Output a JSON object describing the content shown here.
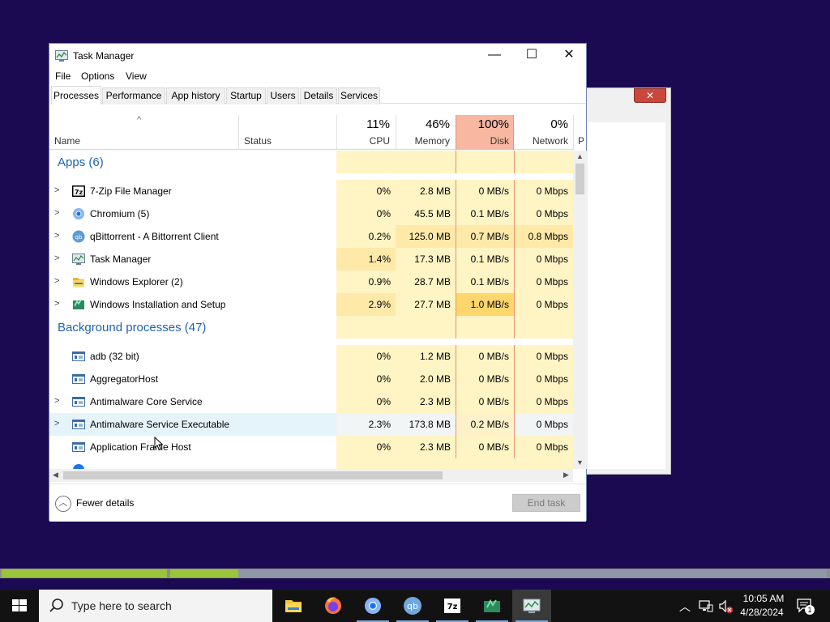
{
  "window": {
    "title": "Task Manager"
  },
  "menu": [
    "File",
    "Options",
    "View"
  ],
  "tabs": [
    "Processes",
    "Performance",
    "App history",
    "Startup",
    "Users",
    "Details",
    "Services"
  ],
  "columns": {
    "name": "Name",
    "status": "Status",
    "cpu": {
      "pct": "11%",
      "label": "CPU"
    },
    "memory": {
      "pct": "46%",
      "label": "Memory"
    },
    "disk": {
      "pct": "100%",
      "label": "Disk"
    },
    "network": {
      "pct": "0%",
      "label": "Network"
    },
    "power": "P"
  },
  "groups": {
    "apps": "Apps (6)",
    "background": "Background processes (47)"
  },
  "apps": [
    {
      "name": "7-Zip File Manager",
      "cpu": "0%",
      "memory": "2.8 MB",
      "disk": "0 MB/s",
      "network": "0 Mbps",
      "icon": "sevenzip-icon"
    },
    {
      "name": "Chromium (5)",
      "cpu": "0%",
      "memory": "45.5 MB",
      "disk": "0.1 MB/s",
      "network": "0 Mbps",
      "icon": "chromium-icon"
    },
    {
      "name": "qBittorrent - A Bittorrent Client",
      "cpu": "0.2%",
      "memory": "125.0 MB",
      "disk": "0.7 MB/s",
      "network": "0.8 Mbps",
      "icon": "qbittorrent-icon"
    },
    {
      "name": "Task Manager",
      "cpu": "1.4%",
      "memory": "17.3 MB",
      "disk": "0.1 MB/s",
      "network": "0 Mbps",
      "icon": "task-manager-icon"
    },
    {
      "name": "Windows Explorer (2)",
      "cpu": "0.9%",
      "memory": "28.7 MB",
      "disk": "0.1 MB/s",
      "network": "0 Mbps",
      "icon": "explorer-icon"
    },
    {
      "name": "Windows Installation and Setup",
      "cpu": "2.9%",
      "memory": "27.7 MB",
      "disk": "1.0 MB/s",
      "network": "0 Mbps",
      "icon": "setup-icon"
    }
  ],
  "background": [
    {
      "name": "adb (32 bit)",
      "cpu": "0%",
      "memory": "1.2 MB",
      "disk": "0 MB/s",
      "network": "0 Mbps"
    },
    {
      "name": "AggregatorHost",
      "cpu": "0%",
      "memory": "2.0 MB",
      "disk": "0 MB/s",
      "network": "0 Mbps"
    },
    {
      "name": "Antimalware Core Service",
      "cpu": "0%",
      "memory": "2.3 MB",
      "disk": "0 MB/s",
      "network": "0 Mbps"
    },
    {
      "name": "Antimalware Service Executable",
      "cpu": "2.3%",
      "memory": "173.8 MB",
      "disk": "0.2 MB/s",
      "network": "0 Mbps"
    },
    {
      "name": "Application Frame Host",
      "cpu": "0%",
      "memory": "2.3 MB",
      "disk": "0 MB/s",
      "network": "0 Mbps"
    }
  ],
  "footer": {
    "fewer_details": "Fewer details",
    "end_task": "End task"
  },
  "taskbar": {
    "search_placeholder": "Type here to search",
    "time": "10:05 AM",
    "date": "4/28/2024",
    "notification_count": "1"
  },
  "colors": {
    "desktop": "#1b0a52",
    "heat_light": "#fff4c4",
    "heat_mid": "#ffe9a8",
    "heat_high": "#ffd66b",
    "disk_header": "#f8b7a1",
    "group_title": "#1f63b0"
  }
}
